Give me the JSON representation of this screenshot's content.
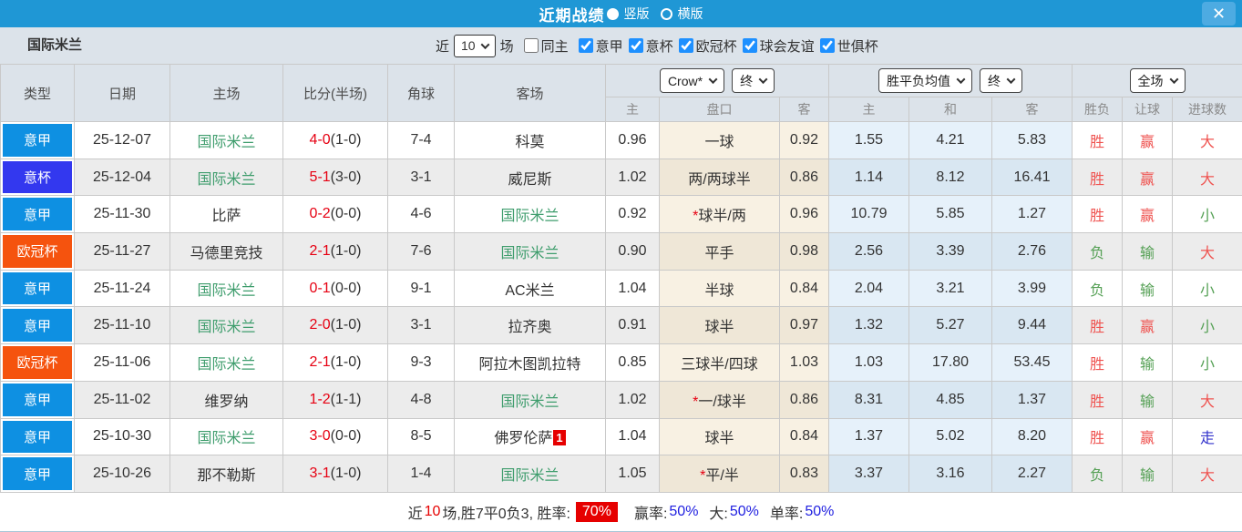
{
  "titlebar": {
    "title": "近期战绩",
    "close": "✕",
    "layout_options": [
      {
        "label": "竖版",
        "selected": true
      },
      {
        "label": "横版",
        "selected": false
      }
    ]
  },
  "filter": {
    "team": "国际米兰",
    "near_label": "近",
    "matches_value": "10",
    "matches_label": "场",
    "same_home": {
      "label": "同主",
      "checked": false
    },
    "leagues": [
      {
        "label": "意甲",
        "checked": true
      },
      {
        "label": "意杯",
        "checked": true
      },
      {
        "label": "欧冠杯",
        "checked": true
      },
      {
        "label": "球会友谊",
        "checked": true
      },
      {
        "label": "世俱杯",
        "checked": true
      }
    ]
  },
  "table": {
    "col_headers": [
      "类型",
      "日期",
      "主场",
      "比分(半场)",
      "角球",
      "客场"
    ],
    "dropdowns": {
      "company": "Crow*",
      "company_state": "终",
      "market": "胜平负均值",
      "market_state": "终",
      "scope": "全场"
    },
    "subheaders": [
      "主",
      "盘口",
      "客",
      "主",
      "和",
      "客",
      "胜负",
      "让球",
      "进球数"
    ],
    "rows": [
      {
        "league": "意甲",
        "date": "25-12-07",
        "home": "国际米兰",
        "home_self": true,
        "score": "4-0",
        "half": "(1-0)",
        "corners": "7-4",
        "away": "科莫",
        "away_self": false,
        "away_badge": "",
        "hcp_home": "0.96",
        "hcp_star": "",
        "hcp_line": "一球",
        "hcp_away": "0.92",
        "odds_home": "1.55",
        "odds_draw": "4.21",
        "odds_away": "5.83",
        "result": "胜",
        "result_color": "red",
        "hcp_result": "赢",
        "hcp_result_color": "red",
        "goals": "大",
        "goals_color": "red"
      },
      {
        "league": "意杯",
        "date": "25-12-04",
        "home": "国际米兰",
        "home_self": true,
        "score": "5-1",
        "half": "(3-0)",
        "corners": "3-1",
        "away": "威尼斯",
        "away_self": false,
        "away_badge": "",
        "hcp_home": "1.02",
        "hcp_star": "",
        "hcp_line": "两/两球半",
        "hcp_away": "0.86",
        "odds_home": "1.14",
        "odds_draw": "8.12",
        "odds_away": "16.41",
        "result": "胜",
        "result_color": "red",
        "hcp_result": "赢",
        "hcp_result_color": "red",
        "goals": "大",
        "goals_color": "red"
      },
      {
        "league": "意甲",
        "date": "25-11-30",
        "home": "比萨",
        "home_self": false,
        "score": "0-2",
        "half": "(0-0)",
        "corners": "4-6",
        "away": "国际米兰",
        "away_self": true,
        "away_badge": "",
        "hcp_home": "0.92",
        "hcp_star": "*",
        "hcp_line": "球半/两",
        "hcp_away": "0.96",
        "odds_home": "10.79",
        "odds_draw": "5.85",
        "odds_away": "1.27",
        "result": "胜",
        "result_color": "red",
        "hcp_result": "赢",
        "hcp_result_color": "red",
        "goals": "小",
        "goals_color": "green"
      },
      {
        "league": "欧冠杯",
        "date": "25-11-27",
        "home": "马德里竞技",
        "home_self": false,
        "score": "2-1",
        "half": "(1-0)",
        "corners": "7-6",
        "away": "国际米兰",
        "away_self": true,
        "away_badge": "",
        "hcp_home": "0.90",
        "hcp_star": "",
        "hcp_line": "平手",
        "hcp_away": "0.98",
        "odds_home": "2.56",
        "odds_draw": "3.39",
        "odds_away": "2.76",
        "result": "负",
        "result_color": "green",
        "hcp_result": "输",
        "hcp_result_color": "green",
        "goals": "大",
        "goals_color": "red"
      },
      {
        "league": "意甲",
        "date": "25-11-24",
        "home": "国际米兰",
        "home_self": true,
        "score": "0-1",
        "half": "(0-0)",
        "corners": "9-1",
        "away": "AC米兰",
        "away_self": false,
        "away_badge": "",
        "hcp_home": "1.04",
        "hcp_star": "",
        "hcp_line": "半球",
        "hcp_away": "0.84",
        "odds_home": "2.04",
        "odds_draw": "3.21",
        "odds_away": "3.99",
        "result": "负",
        "result_color": "green",
        "hcp_result": "输",
        "hcp_result_color": "green",
        "goals": "小",
        "goals_color": "green"
      },
      {
        "league": "意甲",
        "date": "25-11-10",
        "home": "国际米兰",
        "home_self": true,
        "score": "2-0",
        "half": "(1-0)",
        "corners": "3-1",
        "away": "拉齐奥",
        "away_self": false,
        "away_badge": "",
        "hcp_home": "0.91",
        "hcp_star": "",
        "hcp_line": "球半",
        "hcp_away": "0.97",
        "odds_home": "1.32",
        "odds_draw": "5.27",
        "odds_away": "9.44",
        "result": "胜",
        "result_color": "red",
        "hcp_result": "赢",
        "hcp_result_color": "red",
        "goals": "小",
        "goals_color": "green"
      },
      {
        "league": "欧冠杯",
        "date": "25-11-06",
        "home": "国际米兰",
        "home_self": true,
        "score": "2-1",
        "half": "(1-0)",
        "corners": "9-3",
        "away": "阿拉木图凯拉特",
        "away_self": false,
        "away_badge": "",
        "hcp_home": "0.85",
        "hcp_star": "",
        "hcp_line": "三球半/四球",
        "hcp_away": "1.03",
        "odds_home": "1.03",
        "odds_draw": "17.80",
        "odds_away": "53.45",
        "result": "胜",
        "result_color": "red",
        "hcp_result": "输",
        "hcp_result_color": "green",
        "goals": "小",
        "goals_color": "green"
      },
      {
        "league": "意甲",
        "date": "25-11-02",
        "home": "维罗纳",
        "home_self": false,
        "score": "1-2",
        "half": "(1-1)",
        "corners": "4-8",
        "away": "国际米兰",
        "away_self": true,
        "away_badge": "",
        "hcp_home": "1.02",
        "hcp_star": "*",
        "hcp_line": "一/球半",
        "hcp_away": "0.86",
        "odds_home": "8.31",
        "odds_draw": "4.85",
        "odds_away": "1.37",
        "result": "胜",
        "result_color": "red",
        "hcp_result": "输",
        "hcp_result_color": "green",
        "goals": "大",
        "goals_color": "red"
      },
      {
        "league": "意甲",
        "date": "25-10-30",
        "home": "国际米兰",
        "home_self": true,
        "score": "3-0",
        "half": "(0-0)",
        "corners": "8-5",
        "away": "佛罗伦萨",
        "away_self": false,
        "away_badge": "1",
        "hcp_home": "1.04",
        "hcp_star": "",
        "hcp_line": "球半",
        "hcp_away": "0.84",
        "odds_home": "1.37",
        "odds_draw": "5.02",
        "odds_away": "8.20",
        "result": "胜",
        "result_color": "red",
        "hcp_result": "赢",
        "hcp_result_color": "red",
        "goals": "走",
        "goals_color": "blue"
      },
      {
        "league": "意甲",
        "date": "25-10-26",
        "home": "那不勒斯",
        "home_self": false,
        "score": "3-1",
        "half": "(1-0)",
        "corners": "1-4",
        "away": "国际米兰",
        "away_self": true,
        "away_badge": "",
        "hcp_home": "1.05",
        "hcp_star": "*",
        "hcp_line": "平/半",
        "hcp_away": "0.83",
        "odds_home": "3.37",
        "odds_draw": "3.16",
        "odds_away": "2.27",
        "result": "负",
        "result_color": "green",
        "hcp_result": "输",
        "hcp_result_color": "green",
        "goals": "大",
        "goals_color": "red"
      }
    ]
  },
  "footer": {
    "near_label": "近",
    "count": "10",
    "mid": "场,胜7平0负3, 胜率:",
    "win_rate": "70%",
    "segments": [
      {
        "label": "赢率:",
        "value": "50%"
      },
      {
        "label": "大:",
        "value": "50%"
      },
      {
        "label": "单率:",
        "value": "50%"
      }
    ]
  },
  "palette": {
    "leagues": {
      "意甲": "#0e90e2",
      "意杯": "#3338ef",
      "欧冠杯": "#f5530e"
    },
    "bar_blue": "#1f97d5",
    "self_team_green": "#3f9d6d",
    "score_red": "#e60012",
    "win_red": "#ef5350",
    "lose_green": "#55a055",
    "push_blue": "#3333cc",
    "rate_badge_red": "#e60000"
  }
}
